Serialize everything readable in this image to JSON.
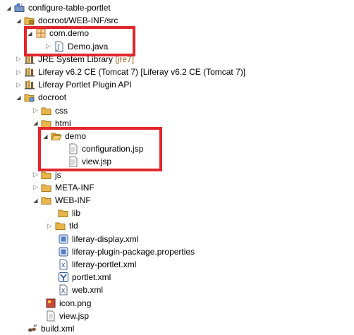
{
  "tree": [
    {
      "name": "project-configure-table-portlet",
      "label": "configure-table-portlet",
      "icon": "project-icon",
      "twisty": "open",
      "indent": 8
    },
    {
      "name": "folder-docroot-webinf-src",
      "label": "docroot/WEB-INF/src",
      "icon": "source-folder-icon",
      "twisty": "open",
      "indent": 22
    },
    {
      "name": "package-com-demo",
      "label": "com.demo",
      "icon": "package-icon",
      "twisty": "open",
      "indent": 38
    },
    {
      "name": "file-demo-java",
      "label": "Demo.java",
      "icon": "java-file-icon",
      "twisty": "closed",
      "indent": 64
    },
    {
      "name": "library-jre-system",
      "label": "JRE System Library",
      "decor": "[jre7]",
      "icon": "library-icon",
      "twisty": "closed",
      "indent": 22
    },
    {
      "name": "library-liferay-tomcat",
      "label": "Liferay v6.2 CE (Tomcat 7) [Liferay v6.2 CE (Tomcat 7)]",
      "icon": "library-icon",
      "twisty": "closed",
      "indent": 22
    },
    {
      "name": "library-liferay-plugin-api",
      "label": "Liferay Portlet Plugin API",
      "icon": "library-icon",
      "twisty": "closed",
      "indent": 22
    },
    {
      "name": "folder-docroot",
      "label": "docroot",
      "icon": "web-folder-icon",
      "twisty": "open",
      "indent": 22
    },
    {
      "name": "folder-css",
      "label": "css",
      "icon": "folder-icon",
      "twisty": "closed",
      "indent": 46
    },
    {
      "name": "folder-html",
      "label": "html",
      "icon": "folder-icon",
      "twisty": "open",
      "indent": 46
    },
    {
      "name": "folder-demo",
      "label": "demo",
      "icon": "folder-open-icon",
      "twisty": "open",
      "indent": 60
    },
    {
      "name": "file-configuration-jsp",
      "label": "configuration.jsp",
      "icon": "jsp-file-icon",
      "twisty": "none",
      "indent": 84
    },
    {
      "name": "file-view-jsp-demo",
      "label": "view.jsp",
      "icon": "jsp-file-icon",
      "twisty": "none",
      "indent": 84
    },
    {
      "name": "folder-js",
      "label": "js",
      "icon": "folder-icon",
      "twisty": "closed",
      "indent": 46
    },
    {
      "name": "folder-meta-inf",
      "label": "META-INF",
      "icon": "folder-icon",
      "twisty": "closed",
      "indent": 46
    },
    {
      "name": "folder-web-inf",
      "label": "WEB-INF",
      "icon": "folder-icon",
      "twisty": "open",
      "indent": 46
    },
    {
      "name": "folder-lib",
      "label": "lib",
      "icon": "folder-icon",
      "twisty": "none",
      "indent": 70
    },
    {
      "name": "folder-tld",
      "label": "tld",
      "icon": "folder-icon",
      "twisty": "closed",
      "indent": 66
    },
    {
      "name": "file-liferay-display-xml",
      "label": "liferay-display.xml",
      "icon": "xml-config-icon",
      "twisty": "none",
      "indent": 70
    },
    {
      "name": "file-liferay-plugin-package",
      "label": "liferay-plugin-package.properties",
      "icon": "xml-config-icon",
      "twisty": "none",
      "indent": 70
    },
    {
      "name": "file-liferay-portlet-xml",
      "label": "liferay-portlet.xml",
      "icon": "xml-file-icon",
      "twisty": "none",
      "indent": 70
    },
    {
      "name": "file-portlet-xml",
      "label": "portlet.xml",
      "icon": "portlet-xml-icon",
      "twisty": "none",
      "indent": 70
    },
    {
      "name": "file-web-xml",
      "label": "web.xml",
      "icon": "xml-file-icon",
      "twisty": "none",
      "indent": 70
    },
    {
      "name": "file-icon-png",
      "label": "icon.png",
      "icon": "image-file-icon",
      "twisty": "none",
      "indent": 52
    },
    {
      "name": "file-view-jsp",
      "label": "view.jsp",
      "icon": "jsp-file-icon",
      "twisty": "none",
      "indent": 52
    },
    {
      "name": "file-build-xml",
      "label": "build.xml",
      "icon": "ant-file-icon",
      "twisty": "none",
      "indent": 26
    }
  ],
  "colors": {
    "highlight": "#e3262c",
    "folder": "#e8b64a",
    "package": "#c0701a",
    "library": "#9a7b3c"
  }
}
